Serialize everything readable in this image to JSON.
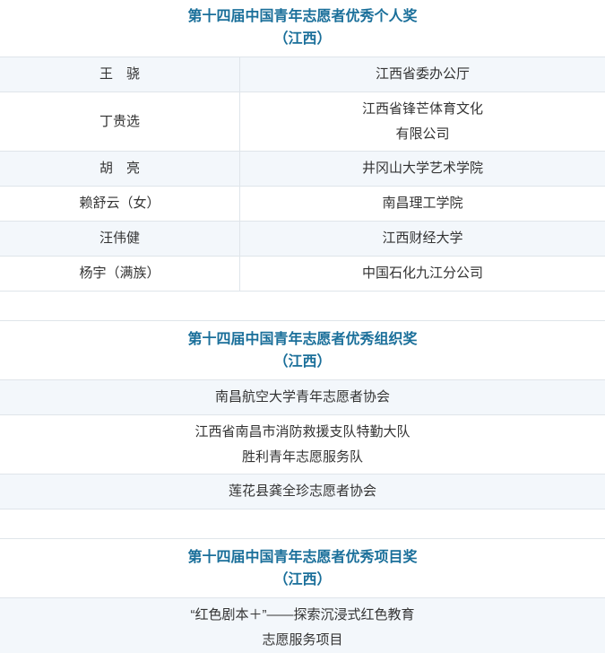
{
  "sections": [
    {
      "title": "第十四届中国青年志愿者优秀个人奖",
      "subtitle": "（江西）",
      "rows": [
        {
          "name": "王　骁",
          "org": "江西省委办公厅"
        },
        {
          "name": "丁贵选",
          "org": "江西省锋芒体育文化\n有限公司"
        },
        {
          "name": "胡　亮",
          "org": "井冈山大学艺术学院"
        },
        {
          "name": "赖舒云（女）",
          "org": "南昌理工学院"
        },
        {
          "name": "汪伟健",
          "org": "江西财经大学"
        },
        {
          "name": "杨宇（满族）",
          "org": "中国石化九江分公司"
        }
      ]
    },
    {
      "title": "第十四届中国青年志愿者优秀组织奖",
      "subtitle": "（江西）",
      "rows": [
        "南昌航空大学青年志愿者协会",
        "江西省南昌市消防救援支队特勤大队\n胜利青年志愿服务队",
        "莲花县龚全珍志愿者协会"
      ]
    },
    {
      "title": "第十四届中国青年志愿者优秀项目奖",
      "subtitle": "（江西）",
      "rows": [
        "“红色剧本＋”——探索沉浸式红色教育\n志愿服务项目"
      ]
    }
  ]
}
